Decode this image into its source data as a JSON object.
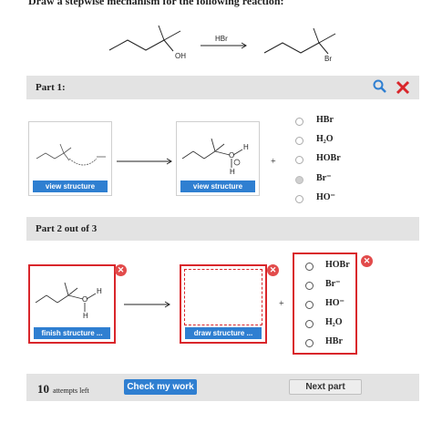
{
  "question": {
    "title": "Draw a stepwise mechanism for the following reaction:",
    "reactant_label": "OH",
    "reagent": "HBr",
    "product_label": "Br"
  },
  "part1": {
    "label": "Part 1:",
    "panel_left_button": "view structure",
    "panel_right_button": "view structure",
    "plus": "+",
    "options": [
      {
        "label": "HBr",
        "selected": false
      },
      {
        "label": "H₂O",
        "selected": false
      },
      {
        "label": "HOBr",
        "selected": false
      },
      {
        "label": "Br⁻",
        "selected": true
      },
      {
        "label": "HO⁻",
        "selected": false
      }
    ]
  },
  "part2": {
    "label": "Part 2 out of 3",
    "finish_button": "finish structure ...",
    "draw_button": "draw structure ...",
    "plus": "+",
    "options": [
      {
        "label": "HOBr"
      },
      {
        "label": "Br⁻"
      },
      {
        "label": "HO⁻"
      },
      {
        "label": "H₂O"
      },
      {
        "label": "HBr"
      }
    ]
  },
  "footer": {
    "attempts_count": "10",
    "attempts_label": "attempts left",
    "check_button": "Check my work",
    "next_button": "Next part"
  },
  "colors": {
    "accent": "#2f7fd1",
    "error": "#d9262b",
    "bar": "#e3e3e3"
  },
  "icons": [
    "search-icon",
    "close-icon"
  ]
}
